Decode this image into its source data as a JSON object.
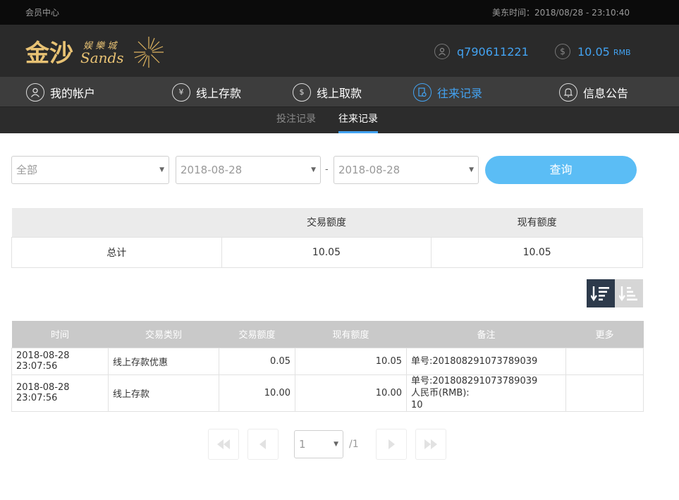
{
  "topbar": {
    "member_center": "会员中心",
    "time_label": "美东时间：2018/08/28 - 23:10:40"
  },
  "header": {
    "username": "q790611221",
    "balance": "10.05",
    "currency": "RMB"
  },
  "nav": [
    {
      "label": "我的帐户",
      "icon": "user-icon"
    },
    {
      "label": "线上存款",
      "icon": "deposit-icon"
    },
    {
      "label": "线上取款",
      "icon": "withdraw-icon"
    },
    {
      "label": "往来记录",
      "icon": "records-icon",
      "active": true
    },
    {
      "label": "信息公告",
      "icon": "bell-icon"
    }
  ],
  "subtabs": [
    {
      "label": "投注记录"
    },
    {
      "label": "往来记录",
      "active": true
    }
  ],
  "filters": {
    "type_value": "全部",
    "start_date": "2018-08-28",
    "end_date": "2018-08-28",
    "separator": "-",
    "query_label": "查询"
  },
  "summary": {
    "headers": [
      "",
      "交易额度",
      "现有额度"
    ],
    "row": [
      "总计",
      "10.05",
      "10.05"
    ]
  },
  "records": {
    "headers": [
      "时间",
      "交易类别",
      "交易额度",
      "现有额度",
      "备注",
      "更多"
    ],
    "rows": [
      {
        "time": "2018-08-28 23:07:56",
        "type": "线上存款优惠",
        "amount": "0.05",
        "balance": "10.05",
        "memo1": "单号:201808291073789039",
        "memo2": "",
        "memo3": "",
        "more": ""
      },
      {
        "time": "2018-08-28 23:07:56",
        "type": "线上存款",
        "amount": "10.00",
        "balance": "10.00",
        "memo1": "单号:201808291073789039",
        "memo2": "人民币(RMB):",
        "memo3": "10",
        "more": ""
      }
    ]
  },
  "pagination": {
    "page": "1",
    "total": "/1"
  },
  "colors": {
    "accent": "#43a3f2",
    "button": "#5bbdf5",
    "sort_active": "#2d3a4b"
  }
}
